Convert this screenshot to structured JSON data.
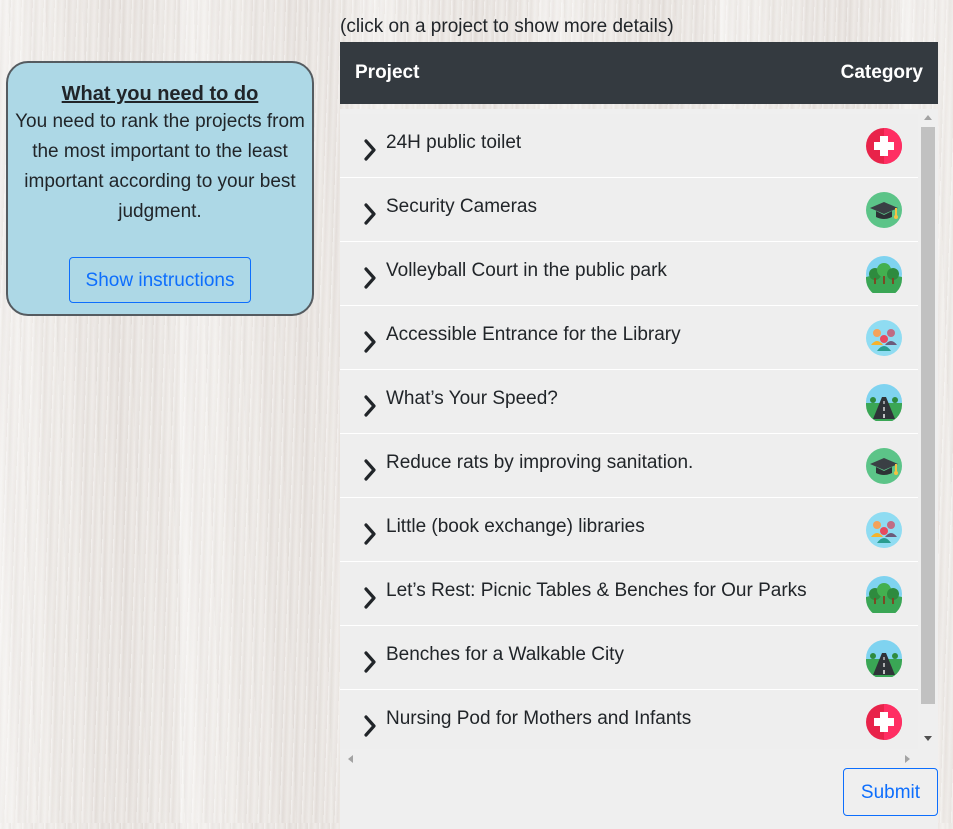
{
  "info": {
    "title": "What you need to do",
    "text": "You need to rank the projects from the most important to the least important according to your best judgment.",
    "instructions_button": "Show instructions"
  },
  "hint": "(click on a project to show more details)",
  "table": {
    "col_project": "Project",
    "col_category": "Category",
    "rows": [
      {
        "label": "24H public toilet",
        "category_icon": "health-cross-icon"
      },
      {
        "label": "Security Cameras",
        "category_icon": "education-cap-icon"
      },
      {
        "label": "Volleyball Court in the public park",
        "category_icon": "parks-trees-icon"
      },
      {
        "label": "Accessible Entrance for the Library",
        "category_icon": "community-people-icon"
      },
      {
        "label": "What’s Your Speed?",
        "category_icon": "streets-road-icon"
      },
      {
        "label": "Reduce rats by improving sanitation.",
        "category_icon": "education-cap-icon"
      },
      {
        "label": "Little (book exchange) libraries",
        "category_icon": "community-people-icon"
      },
      {
        "label": "Let’s Rest: Picnic Tables & Benches for Our Parks",
        "category_icon": "parks-trees-icon"
      },
      {
        "label": "Benches for a Walkable City",
        "category_icon": "streets-road-icon"
      },
      {
        "label": "Nursing Pod for Mothers and Infants",
        "category_icon": "health-cross-icon"
      }
    ]
  },
  "submit_label": "Submit",
  "colors": {
    "card_bg": "#add8e6",
    "header_bg": "#343a40",
    "primary": "#0d6efd"
  }
}
